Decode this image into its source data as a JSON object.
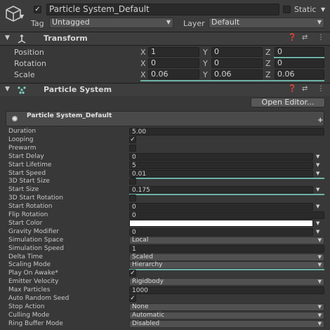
{
  "gameobject": {
    "active": true,
    "name": "Particle System_Default",
    "static_label": "Static",
    "tag_label": "Tag",
    "tag_value": "Untagged",
    "layer_label": "Layer",
    "layer_value": "Default"
  },
  "transform": {
    "title": "Transform",
    "rows": [
      {
        "label": "Position",
        "x": "1",
        "y": "0",
        "z": "0"
      },
      {
        "label": "Rotation",
        "x": "0",
        "y": "0",
        "z": "0"
      },
      {
        "label": "Scale",
        "x": "0.06",
        "y": "0.06",
        "z": "0.06"
      }
    ],
    "axis_labels": [
      "X",
      "Y",
      "Z"
    ]
  },
  "particle_system": {
    "title": "Particle System",
    "open_editor_label": "Open Editor...",
    "module_title": "Particle System_Default",
    "module_plus": "+",
    "properties": [
      {
        "label": "Duration",
        "kind": "field",
        "value": "5.00"
      },
      {
        "label": "Looping",
        "kind": "check",
        "value": "✓"
      },
      {
        "label": "Prewarm",
        "kind": "check",
        "value": ""
      },
      {
        "label": "Start Delay",
        "kind": "field_dd",
        "value": "0"
      },
      {
        "label": "Start Lifetime",
        "kind": "field_dd",
        "value": "5"
      },
      {
        "label": "Start Speed",
        "kind": "field_dd",
        "value": "0.01"
      },
      {
        "label": "3D Start Size",
        "kind": "check",
        "value": ""
      },
      {
        "label": "Start Size",
        "kind": "field_dd",
        "value": "0.175"
      },
      {
        "label": "3D Start Rotation",
        "kind": "check",
        "value": ""
      },
      {
        "label": "Start Rotation",
        "kind": "field_dd",
        "value": "0"
      },
      {
        "label": "Flip Rotation",
        "kind": "field",
        "value": "0"
      },
      {
        "label": "Start Color",
        "kind": "color",
        "value": "#ffffff"
      },
      {
        "label": "Gravity Modifier",
        "kind": "field_dd",
        "value": "0"
      },
      {
        "label": "Simulation Space",
        "kind": "dropdown",
        "value": "Local"
      },
      {
        "label": "Simulation Speed",
        "kind": "field",
        "value": "1"
      },
      {
        "label": "Delta Time",
        "kind": "dropdown",
        "value": "Scaled"
      },
      {
        "label": "Scaling Mode",
        "kind": "dropdown",
        "value": "Hierarchy"
      },
      {
        "label": "Play On Awake*",
        "kind": "check",
        "value": "✓"
      },
      {
        "label": "Emitter Velocity",
        "kind": "dropdown",
        "value": "Rigidbody"
      },
      {
        "label": "Max Particles",
        "kind": "field",
        "value": "1000"
      },
      {
        "label": "Auto Random Seed",
        "kind": "check",
        "value": "✓"
      },
      {
        "label": "Stop Action",
        "kind": "dropdown",
        "value": "None"
      },
      {
        "label": "Culling Mode",
        "kind": "dropdown",
        "value": "Automatic"
      },
      {
        "label": "Ring Buffer Mode",
        "kind": "dropdown",
        "value": "Disabled"
      }
    ]
  },
  "colors": {
    "panel_bg": "#383838",
    "header_bg": "#3e3e3e",
    "field_bg": "#2a2a2a",
    "accent_teal": "#6db3a8"
  }
}
